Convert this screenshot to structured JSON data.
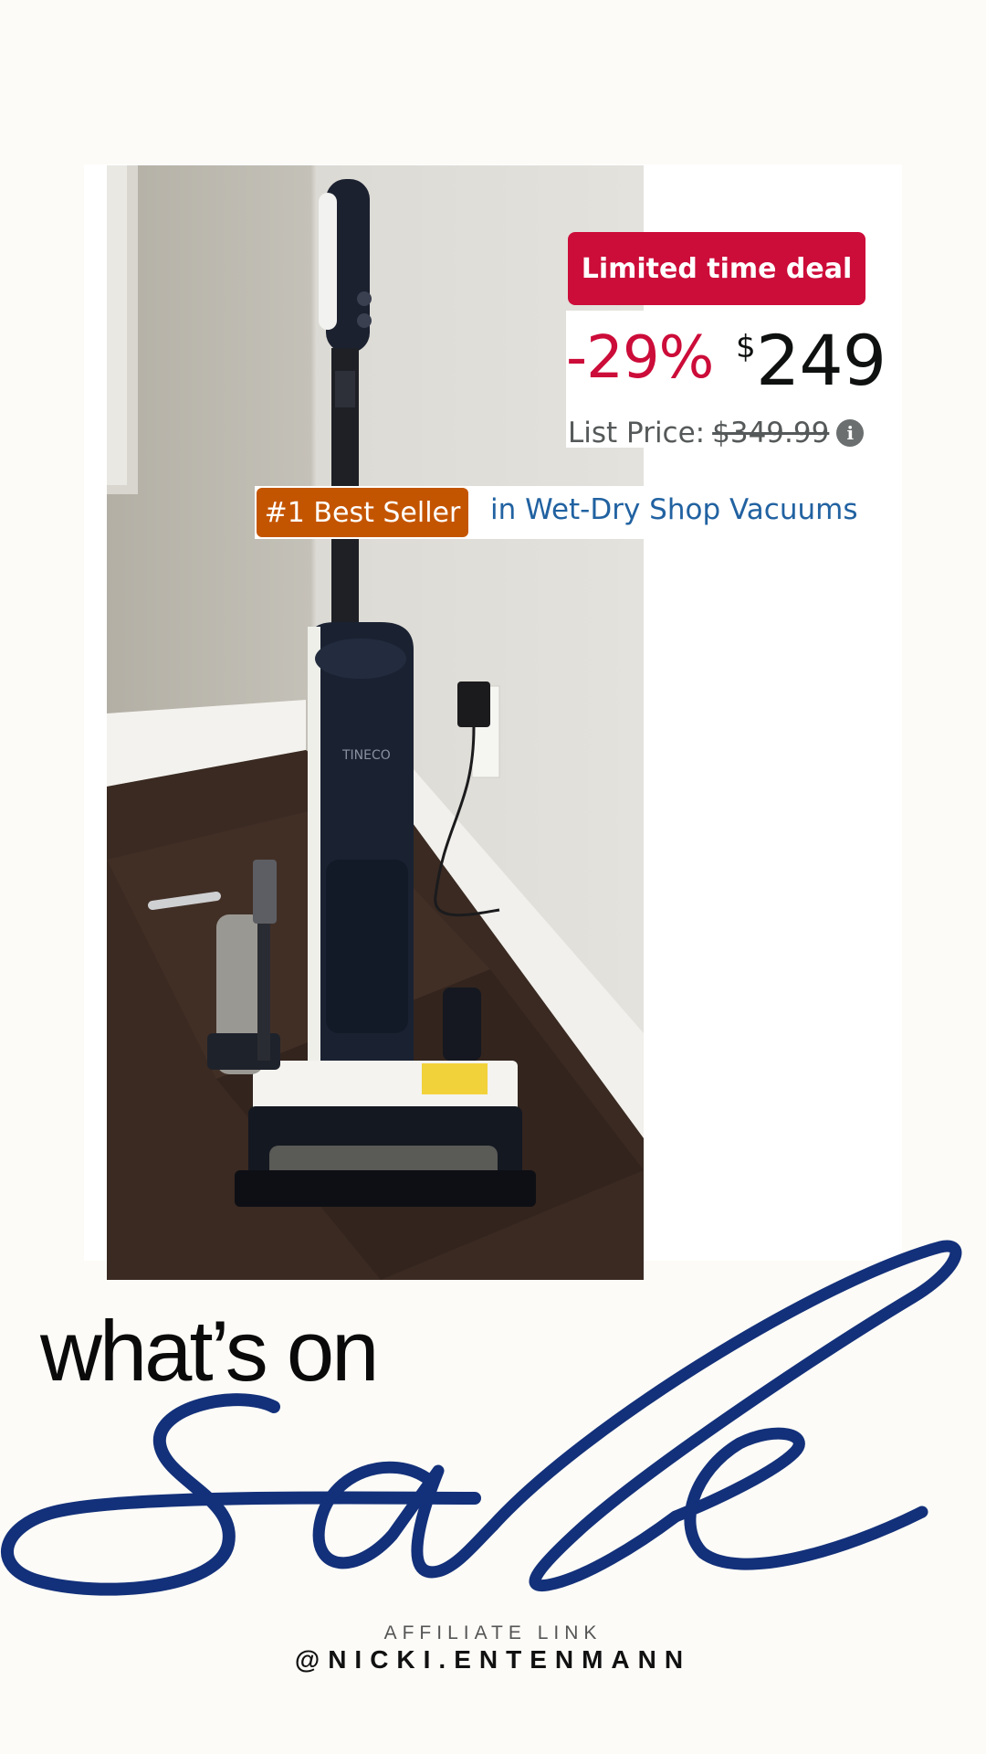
{
  "deal": {
    "badge_label": "Limited time deal",
    "discount": "-29%",
    "currency_symbol": "$",
    "price": "249",
    "list_price_label": "List Price:",
    "list_price_value": "$349.99",
    "info_icon": "info-icon"
  },
  "best_seller": {
    "badge_label": "#1 Best Seller",
    "category": "in Wet-Dry Shop Vacuums"
  },
  "product": {
    "image_subject": "product-photo",
    "brand_mark": "TINECO"
  },
  "headline": {
    "line1": "what’s on",
    "script_word": "sale"
  },
  "footer": {
    "disclosure": "AFFILIATE LINK",
    "handle": "@NICKI.ENTENMANN"
  },
  "colors": {
    "deal_red": "#cc0c39",
    "best_seller_orange": "#c45500",
    "link_blue": "#2162a1",
    "script_navy": "#13307a",
    "background": "#fcfbf7"
  }
}
